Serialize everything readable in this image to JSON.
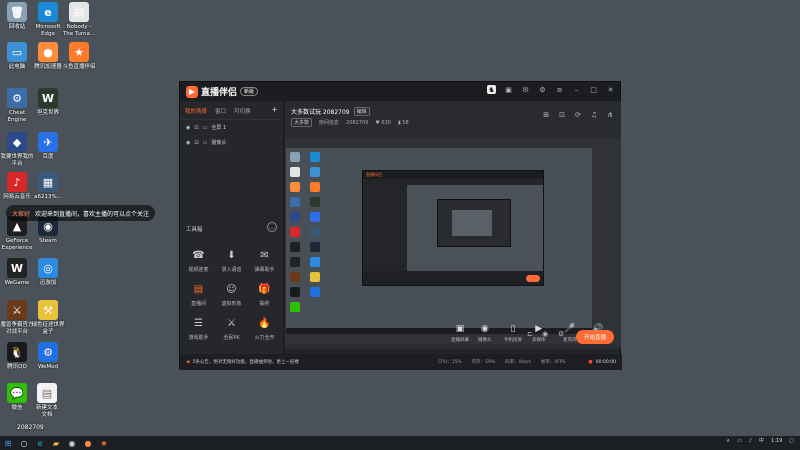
{
  "desktop": {
    "icons": [
      {
        "label": "回收站",
        "color": "#8aa0b5",
        "glyph": "🗑"
      },
      {
        "label": "Microsoft\nEdge",
        "color": "#1a8ad4",
        "glyph": "e"
      },
      {
        "label": "Nobody -\nThe Turna...",
        "color": "#e6e6e6",
        "glyph": "▤"
      },
      {
        "label": "此电脑",
        "color": "#3d8fd6",
        "glyph": "▭"
      },
      {
        "label": "腾讯加速器",
        "color": "#ff8c3a",
        "glyph": "●"
      },
      {
        "label": "斗鱼直播伴侣",
        "color": "#ff7a2a",
        "glyph": "★"
      },
      {
        "label": "Cheat\nEngine",
        "color": "#3b6ea8",
        "glyph": "⚙"
      },
      {
        "label": "坦克世界",
        "color": "#2c3a2c",
        "glyph": "W"
      },
      {
        "label": "我要世界我的\n平台",
        "color": "#2c4a8a",
        "glyph": "◆"
      },
      {
        "label": "百度",
        "color": "#2a6ee8",
        "glyph": "✈"
      },
      {
        "label": "网易云音乐",
        "color": "#d62828",
        "glyph": "♪"
      },
      {
        "label": "a6213%...",
        "color": "#3a5a7a",
        "glyph": "▦"
      },
      {
        "label": "GeForce\nExperience",
        "color": "#1f1f1f",
        "glyph": "▲"
      },
      {
        "label": "Steam",
        "color": "#1b2838",
        "glyph": "◉"
      },
      {
        "label": "WeGame",
        "color": "#222222",
        "glyph": "W"
      },
      {
        "label": "迅游加",
        "color": "#2d8ae0",
        "glyph": "◎"
      },
      {
        "label": "魔兽争霸官方\n对战平台",
        "color": "#6a3a1a",
        "glyph": "⚔"
      },
      {
        "label": "绿色征途世界\n盒子",
        "color": "#e8c23a",
        "glyph": "⚒"
      },
      {
        "label": "腾讯QQ",
        "color": "#1a1a1a",
        "glyph": "🐧"
      },
      {
        "label": "WeMod",
        "color": "#2070e0",
        "glyph": "⚙"
      },
      {
        "label": "微信",
        "color": "#2dc100",
        "glyph": "💬"
      }
    ],
    "file_icon": {
      "label": "新建文本\n文档",
      "glyph": "▤"
    },
    "overlay_number": "2082709",
    "danmaku": {
      "user": "大家好",
      "text": "欢迎来到直播间，喜欢主播的可以点个关注"
    }
  },
  "app": {
    "name": "直播伴侣",
    "version_badge": "新版",
    "left_tabs": [
      "我的场景",
      "窗口",
      "可切换"
    ],
    "scenes": [
      {
        "label": "全屏 1",
        "icon": "▭"
      },
      {
        "label": "摄像头",
        "icon": "▭"
      }
    ],
    "toolbox_title": "工具箱",
    "tools": [
      {
        "label": "视频连麦",
        "glyph": "☎",
        "hot": false
      },
      {
        "label": "录入语音",
        "glyph": "⬇",
        "hot": false
      },
      {
        "label": "弹幕助手",
        "glyph": "✉",
        "hot": false
      },
      {
        "label": "直播间",
        "glyph": "▤",
        "hot": true
      },
      {
        "label": "虚拟形象",
        "glyph": "☺",
        "hot": false
      },
      {
        "label": "抽奖",
        "glyph": "🎁",
        "hot": true
      },
      {
        "label": "游戏助手",
        "glyph": "☰",
        "hot": false
      },
      {
        "label": "全民PK",
        "glyph": "⚔",
        "hot": false
      },
      {
        "label": "火力全开",
        "glyph": "🔥",
        "hot": false
      }
    ],
    "stream": {
      "title": "大多数试玩 2082709",
      "edit_label": "编辑",
      "category": "大多数",
      "room_label": "房间信息",
      "room_id": "2082709",
      "fans": "630",
      "level": "58"
    },
    "controls": [
      {
        "label": "直播屏幕",
        "glyph": "▣"
      },
      {
        "label": "摄像头",
        "glyph": "◉"
      },
      {
        "label": "手机投屏",
        "glyph": "▯"
      },
      {
        "label": "多媒体",
        "glyph": "▶"
      },
      {
        "label": "麦克风",
        "glyph": "🎤"
      },
      {
        "label": "扬声器",
        "glyph": "🔊"
      }
    ],
    "start_button": "开始直播",
    "status": {
      "notice": "5条公告，绝对无限好功能，直播抽奖啦，更上一层楼",
      "cpu": "CPU：15%",
      "mem": "内存：59%",
      "bitrate": "码率：0kb/s",
      "fps": "帧率：0FPS",
      "timer": "00:00:00"
    }
  },
  "taskbar": {
    "time": "1:19",
    "lang": "中"
  }
}
